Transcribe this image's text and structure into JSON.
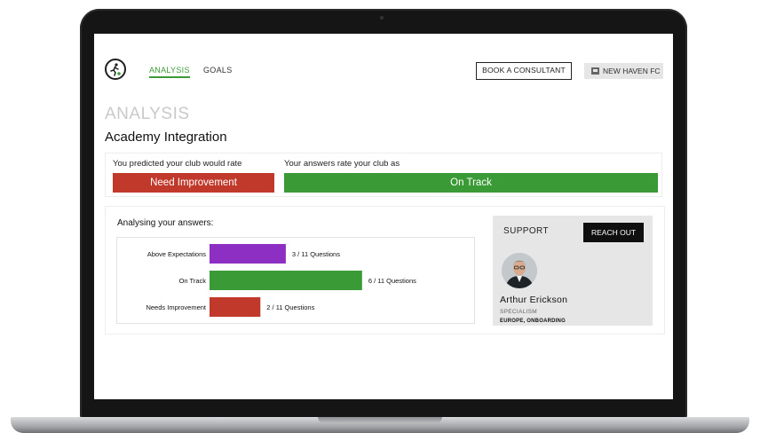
{
  "nav": {
    "items": [
      {
        "label": "ANALYSIS",
        "active": true
      },
      {
        "label": "GOALS",
        "active": false
      }
    ],
    "consult_label": "BOOK A CONSULTANT",
    "club_label": "NEW HAVEN FC"
  },
  "page": {
    "heading": "ANALYSIS",
    "title": "Academy Integration"
  },
  "rating": {
    "predicted_label": "You predicted your club would rate",
    "predicted_value": "Need Improvement",
    "answers_label": "Your answers rate your club as",
    "answers_value": "On Track"
  },
  "analysis": {
    "title": "Analysing your answers:",
    "rows": [
      {
        "label": "Above Expectations",
        "count": 3,
        "total": 11,
        "text": "3 / 11 Questions",
        "color": "#8e2fc3"
      },
      {
        "label": "On Track",
        "count": 6,
        "total": 11,
        "text": "6 / 11 Questions",
        "color": "#3a9a35"
      },
      {
        "label": "Needs Improvement",
        "count": 2,
        "total": 11,
        "text": "2 / 11 Questions",
        "color": "#c0392b"
      }
    ]
  },
  "support": {
    "title": "SUPPORT",
    "button_label": "REACH OUT",
    "person_name": "Arthur Erickson",
    "role_label": "SPECIALISM",
    "focus": "EUROPE, ONBOARDING"
  },
  "colors": {
    "accent_green": "#3a9a35",
    "alert_red": "#c0392b",
    "purple": "#8e2fc3"
  }
}
